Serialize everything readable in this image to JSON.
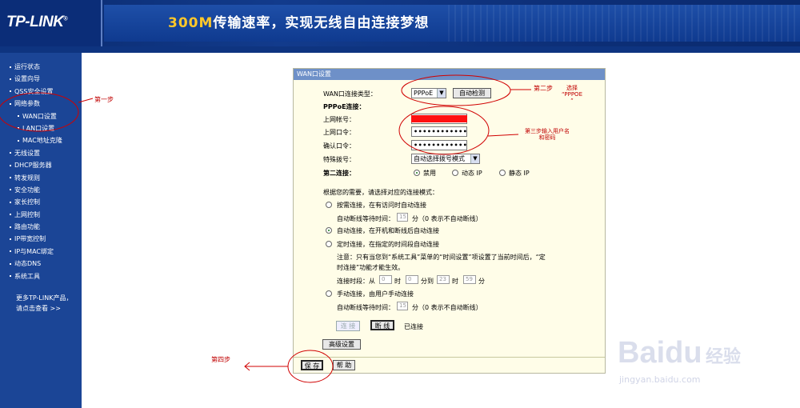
{
  "header": {
    "logo": "TP-LINK",
    "logo_mark": "®",
    "slogan_highlight": "300M",
    "slogan_rest": "传输速率，实现无线自由连接梦想"
  },
  "sidebar": {
    "items": [
      {
        "label": "运行状态",
        "sub": false
      },
      {
        "label": "设置向导",
        "sub": false
      },
      {
        "label": "QSS安全设置",
        "sub": false
      },
      {
        "label": "网络参数",
        "sub": false
      },
      {
        "label": "WAN口设置",
        "sub": true
      },
      {
        "label": "LAN口设置",
        "sub": true
      },
      {
        "label": "MAC地址克隆",
        "sub": true
      },
      {
        "label": "无线设置",
        "sub": false
      },
      {
        "label": "DHCP服务器",
        "sub": false
      },
      {
        "label": "转发规则",
        "sub": false
      },
      {
        "label": "安全功能",
        "sub": false
      },
      {
        "label": "家长控制",
        "sub": false
      },
      {
        "label": "上网控制",
        "sub": false
      },
      {
        "label": "路由功能",
        "sub": false
      },
      {
        "label": "IP带宽控制",
        "sub": false
      },
      {
        "label": "IP与MAC绑定",
        "sub": false
      },
      {
        "label": "动态DNS",
        "sub": false
      },
      {
        "label": "系统工具",
        "sub": false
      }
    ],
    "more_line1": "更多TP-LINK产品，",
    "more_line2": "请点击查看 >>"
  },
  "panel": {
    "title": "WAN口设置",
    "conn_type_label": "WAN口连接类型：",
    "conn_type_value": "PPPoE",
    "auto_detect": "自动检测",
    "pppoe_heading": "PPPoE连接：",
    "account_label": "上网帐号：",
    "password_label": "上网口令：",
    "password_value": "••••••••••••",
    "confirm_label": "确认口令：",
    "confirm_value": "••••••••••••",
    "special_dial_label": "特殊拨号：",
    "special_dial_value": "自动选择拨号模式",
    "second_conn_label": "第二连接：",
    "second_opts": [
      "禁用",
      "动态 IP",
      "静态 IP"
    ],
    "mode_intro": "根据您的需要，请选择对应的连接模式：",
    "mode_demand": "按需连接，在有访问时自动连接",
    "idle_label": "自动断线等待时间：",
    "idle_value": "15",
    "idle_unit": "分（0 表示不自动断线）",
    "mode_auto": "自动连接，在开机和断线后自动连接",
    "mode_timed": "定时连接，在指定的时间段自动连接",
    "note_line1": "注意：只有当您到“系统工具”菜单的“时间设置”项设置了当前时间后，“定",
    "note_line2": "时连接”功能才能生效。",
    "period_label": "连接时段：从",
    "period_h1": "0",
    "period_t1": "时",
    "period_m1": "0",
    "period_to": "分到",
    "period_h2": "23",
    "period_t2": "时",
    "period_m2": "59",
    "period_unit": "分",
    "mode_manual": "手动连接，由用户手动连接",
    "idle2_value": "15",
    "connect_btn": "连 接",
    "disconnect_btn": "断 线",
    "status": "已连接",
    "advanced_btn": "高级设置",
    "save_btn": "保 存",
    "help_btn": "帮 助"
  },
  "annotations": {
    "step1": "第一步",
    "step2": "第二步",
    "step2_note_a": "选择",
    "step2_note_b": "“PPPOE",
    "step2_note_c": "”",
    "step3_a": "第三步输入用户名",
    "step3_b": "和密码",
    "step4": "第四步"
  },
  "watermark": {
    "brand": "Bai",
    "brand2": "du",
    "cn": "经验",
    "url": "jingyan.baidu.com"
  },
  "colors": {
    "sidebar_bg": "#1b4596",
    "panel_bg": "#fffde8",
    "annotation_red": "#c00000"
  }
}
